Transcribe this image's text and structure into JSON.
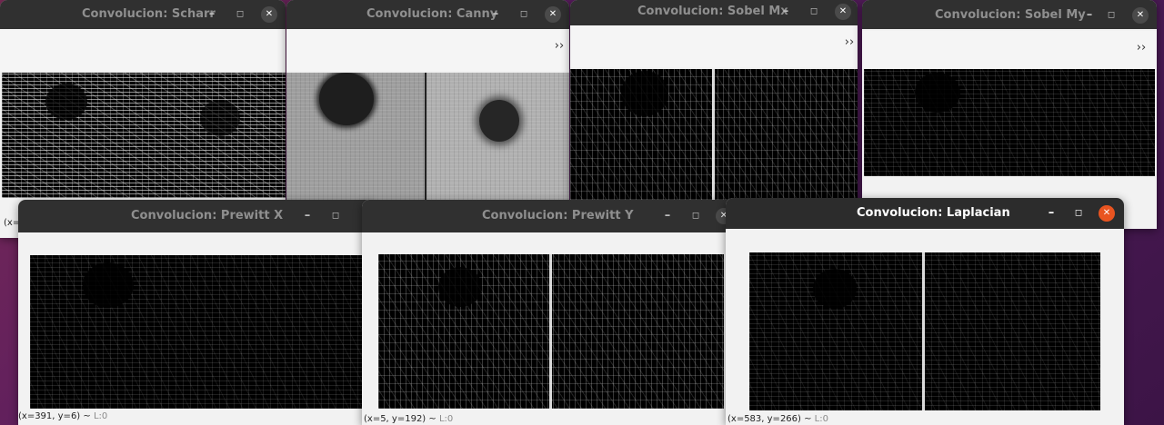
{
  "windows": {
    "scharr": {
      "title": "Convolucion: Scharr",
      "status_partial": "(x="
    },
    "canny": {
      "title": "Convolucion: Canny"
    },
    "sobel_mx": {
      "title": "Convolucion: Sobel Mx"
    },
    "sobel_my": {
      "title": "Convolucion: Sobel My"
    },
    "prewitt_x": {
      "title": "Convolucion: Prewitt X",
      "status_coords": "(x=391, y=6) ~ ",
      "status_level": "L:0"
    },
    "prewitt_y": {
      "title": "Convolucion: Prewitt Y",
      "status_coords": "(x=5, y=192) ~ ",
      "status_level": "L:0"
    },
    "laplacian": {
      "title": "Convolucion: Laplacian",
      "status_coords": "(x=583, y=266) ~ ",
      "status_level": "L:0"
    }
  },
  "controls": {
    "minimize_glyph": "–",
    "maximize_glyph": "◻",
    "close_glyph": "✕",
    "overflow_glyph": "››"
  },
  "colors": {
    "desktop": "#5a1d5f",
    "titlebar": "#303030",
    "close_active": "#e95420"
  }
}
